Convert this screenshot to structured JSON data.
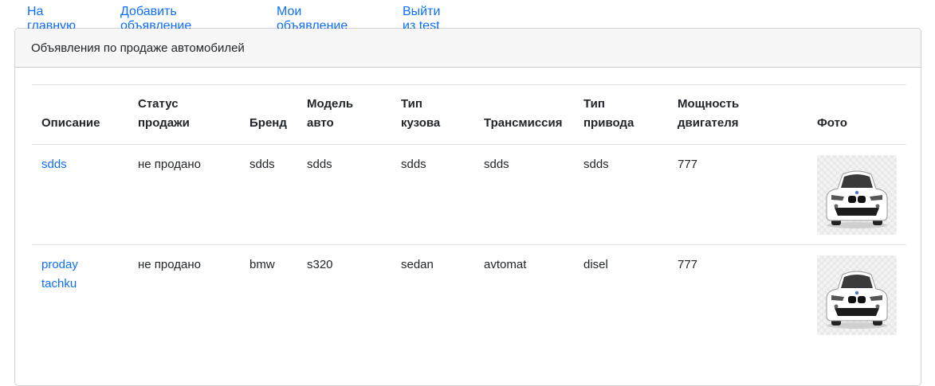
{
  "nav": {
    "home": "На главную",
    "add": "Добавить объявление",
    "mine": "Мои объявление",
    "logout": "Выйти из test"
  },
  "card": {
    "header": "Объявления по продаже автомобилей"
  },
  "table": {
    "headers": {
      "description": "Описание",
      "status_1": "Статус",
      "status_2": "продажи",
      "brand": "Бренд",
      "model_1": "Модель",
      "model_2": "авто",
      "body_1": "Тип",
      "body_2": "кузова",
      "transmission": "Трансмиссия",
      "drive_1": "Тип",
      "drive_2": "привода",
      "power_1": "Мощность",
      "power_2": "двигателя",
      "photo": "Фото"
    },
    "rows": [
      {
        "description_1": "sdds",
        "description_2": "",
        "status": "не продано",
        "brand": "sdds",
        "model": "sdds",
        "body": "sdds",
        "transmission": "sdds",
        "drive": "sdds",
        "power": "777"
      },
      {
        "description_1": "proday",
        "description_2": "tachku",
        "status": "не продано",
        "brand": "bmw",
        "model": "s320",
        "body": "sedan",
        "transmission": "avtomat",
        "drive": "disel",
        "power": "777"
      }
    ]
  },
  "colors": {
    "link": "#0d6efd",
    "header_bg": "#f7f7f7",
    "border": "#dee2e6"
  },
  "icons": {
    "car_photo": "white-car-front-image"
  }
}
